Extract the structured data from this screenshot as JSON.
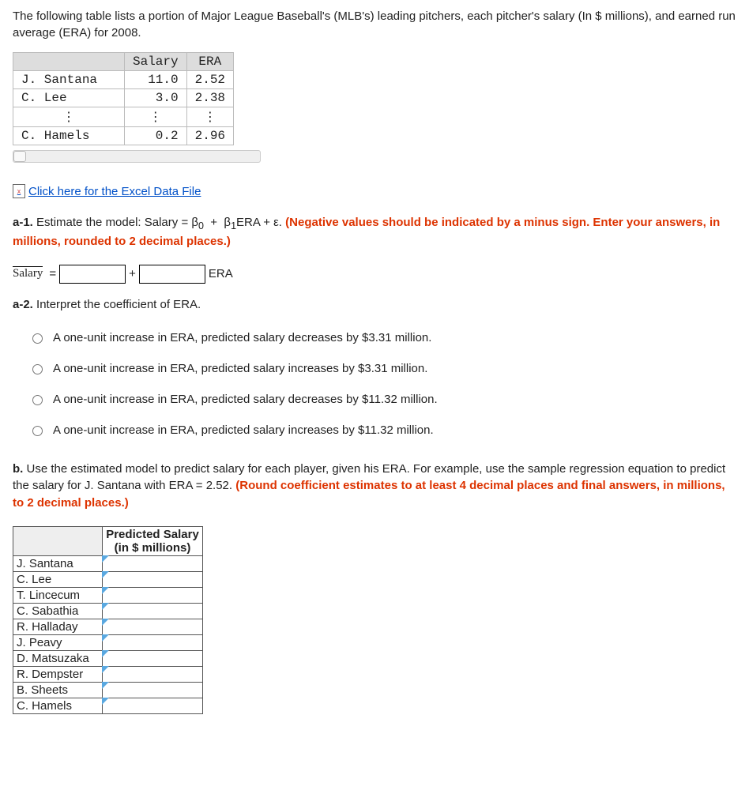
{
  "intro": "The following table lists a portion of Major League Baseball's (MLB's) leading pitchers, each pitcher's salary (In $ millions), and earned run average (ERA) for 2008.",
  "data_table": {
    "headers": {
      "name": "",
      "salary": "Salary",
      "era": "ERA"
    },
    "rows": [
      {
        "name": "J. Santana",
        "salary": "11.0",
        "era": "2.52"
      },
      {
        "name": "C. Lee",
        "salary": "3.0",
        "era": "2.38"
      }
    ],
    "last_row": {
      "name": "C. Hamels",
      "salary": "0.2",
      "era": "2.96"
    },
    "vdots": "⋮"
  },
  "excel_link": "Click here for the Excel Data File",
  "a1": {
    "label": "a-1.",
    "text_plain": " Estimate the model: Salary = ",
    "model_mid": " + ",
    "model_end": "ERA + ε. ",
    "beta0": "β",
    "sub0": "0",
    "beta1": "β",
    "sub1": "1",
    "red": "(Negative values should be indicated by a minus sign. Enter your answers, in millions, rounded to 2 decimal places.)",
    "salary_hat": "Salary",
    "equals": " = ",
    "plus": "+",
    "era_label": "ERA"
  },
  "a2": {
    "label": "a-2.",
    "text": " Interpret the coefficient of ERA.",
    "options": [
      "A one-unit increase in ERA, predicted salary decreases by $3.31 million.",
      "A one-unit increase in ERA, predicted salary increases by $3.31 million.",
      "A one-unit increase in ERA, predicted salary decreases by $11.32 million.",
      "A one-unit increase in ERA, predicted salary increases by $11.32 million."
    ]
  },
  "b": {
    "label": "b.",
    "text": " Use the estimated model to predict salary for each player, given his ERA. For example, use the sample regression equation to predict the salary for J. Santana with ERA = 2.52. ",
    "red": "(Round coefficient estimates to at least 4 decimal places and final answers, in millions, to 2 decimal places.)",
    "header": "Predicted Salary (in $ millions)",
    "players": [
      "J. Santana",
      "C. Lee",
      "T. Lincecum",
      "C. Sabathia",
      "R. Halladay",
      "J. Peavy",
      "D. Matsuzaka",
      "R. Dempster",
      "B. Sheets",
      "C. Hamels"
    ]
  }
}
